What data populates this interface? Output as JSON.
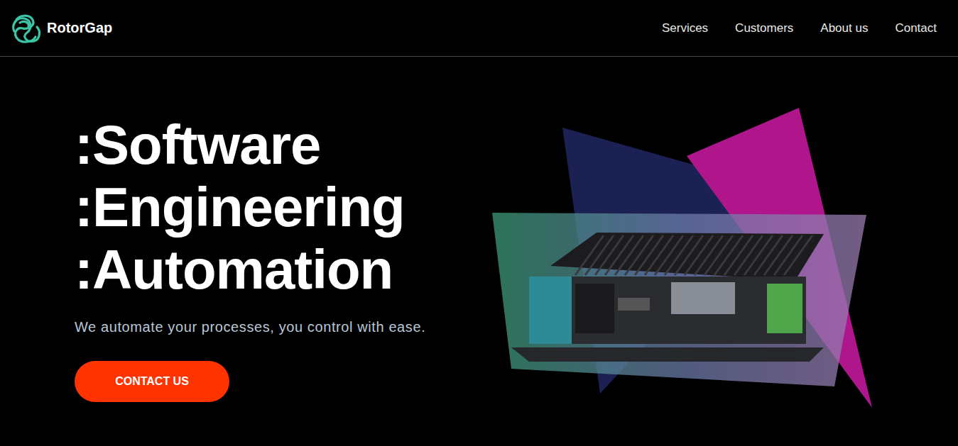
{
  "header": {
    "brand": "RotorGap",
    "nav": [
      {
        "label": "Services"
      },
      {
        "label": "Customers"
      },
      {
        "label": "About us"
      },
      {
        "label": "Contact"
      }
    ]
  },
  "hero": {
    "headlines": [
      ":Software",
      ":Engineering",
      ":Automation"
    ],
    "subtitle": "We automate your processes, you control with ease.",
    "button": "CONTACT US"
  }
}
